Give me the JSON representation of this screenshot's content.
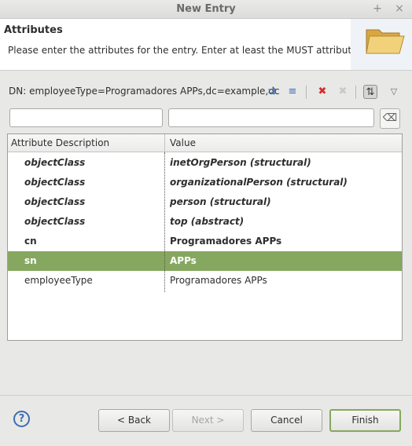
{
  "window": {
    "title": "New Entry",
    "pin_glyph": "+",
    "close_glyph": "×"
  },
  "header": {
    "title": "Attributes",
    "description": "Please enter the attributes for the entry. Enter at least the MUST attributes."
  },
  "dn": {
    "text": "DN: employeeType=Programadores APPs,dc=example,dc"
  },
  "toolbar": {
    "icons": [
      "new-value-icon",
      "new-attribute-icon",
      "delete-icon",
      "delete-all-icon",
      "show-decorated-values-icon",
      "view-menu-icon"
    ],
    "glyphs": {
      "new_value": "⇉",
      "new_attribute": "≡",
      "delete": "✖",
      "delete_all": "✖",
      "toggle": "⇅",
      "menu": "▽"
    }
  },
  "filters": {
    "attribute_value": "",
    "value_value": "",
    "clear_glyph": "⌫"
  },
  "table": {
    "headers": [
      "Attribute Description",
      "Value"
    ],
    "rows": [
      {
        "attribute": "objectClass",
        "value": "inetOrgPerson (structural)",
        "style": "oc"
      },
      {
        "attribute": "objectClass",
        "value": "organizationalPerson (structural)",
        "style": "oc"
      },
      {
        "attribute": "objectClass",
        "value": "person (structural)",
        "style": "oc"
      },
      {
        "attribute": "objectClass",
        "value": "top (abstract)",
        "style": "oc"
      },
      {
        "attribute": "cn",
        "value": "Programadores APPs",
        "style": "must"
      },
      {
        "attribute": "sn",
        "value": "APPs",
        "style": "must",
        "selected": true
      },
      {
        "attribute": "employeeType",
        "value": "Programadores APPs",
        "style": "normal"
      }
    ]
  },
  "buttons": {
    "help": "?",
    "back": "< Back",
    "next": "Next >",
    "cancel": "Cancel",
    "finish": "Finish"
  },
  "colors": {
    "selection": "#86a75f",
    "delete_red": "#d92b2b",
    "help_blue": "#3b6eb0"
  }
}
